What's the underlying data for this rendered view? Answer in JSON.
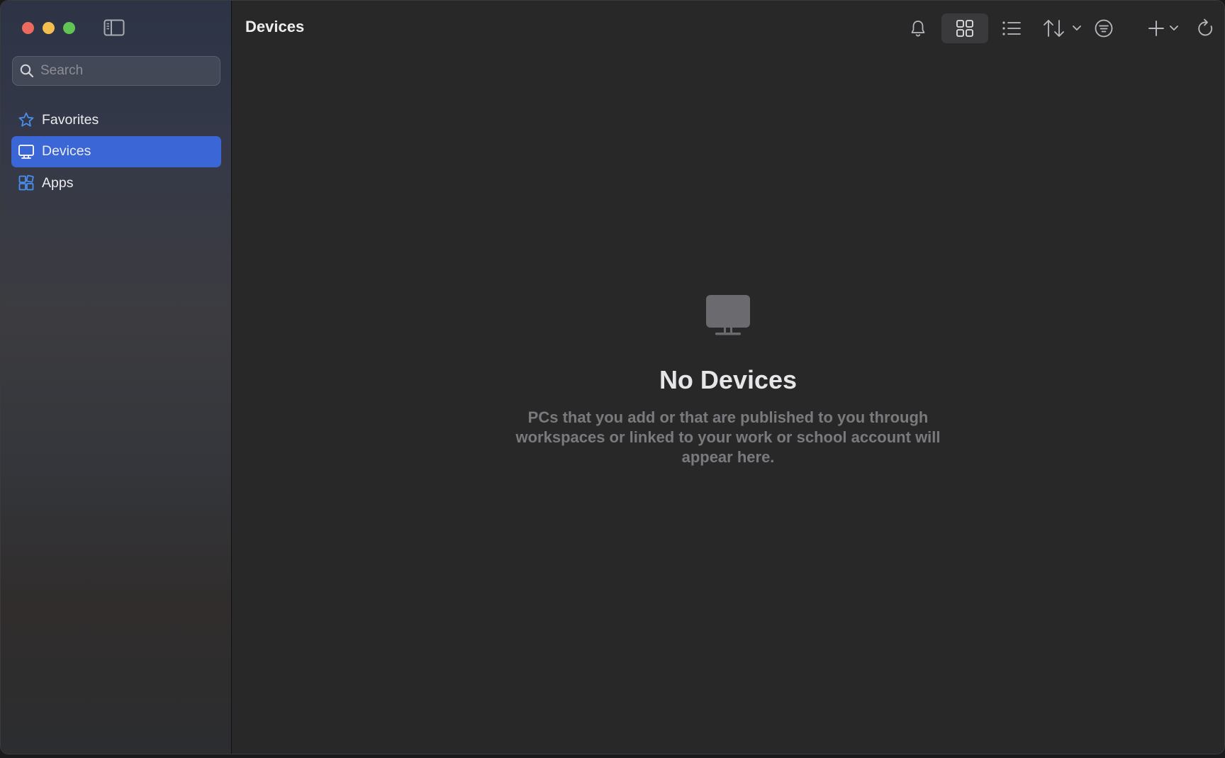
{
  "window": {
    "title": "Devices"
  },
  "sidebar": {
    "search": {
      "placeholder": "Search",
      "value": ""
    },
    "items": [
      {
        "label": "Favorites",
        "icon": "star-icon",
        "active": false
      },
      {
        "label": "Devices",
        "icon": "monitor-icon",
        "active": true
      },
      {
        "label": "Apps",
        "icon": "apps-icon",
        "active": false
      }
    ]
  },
  "toolbar": {
    "buttons": [
      {
        "name": "notifications",
        "icon": "bell-icon"
      },
      {
        "name": "grid-view",
        "icon": "grid-icon",
        "selected": true
      },
      {
        "name": "list-view",
        "icon": "list-icon"
      },
      {
        "name": "sort",
        "icon": "sort-arrows-icon"
      },
      {
        "name": "filter",
        "icon": "filter-icon"
      },
      {
        "name": "add",
        "icon": "plus-icon"
      },
      {
        "name": "refresh",
        "icon": "refresh-icon"
      }
    ]
  },
  "empty_state": {
    "icon": "monitor-icon",
    "title": "No Devices",
    "description": "PCs that you add or that are published to you through workspaces or linked to your work or school account will appear here."
  },
  "colors": {
    "accent": "#3a67d5",
    "icon_blue": "#4a8ef0",
    "main_bg": "#282829"
  }
}
